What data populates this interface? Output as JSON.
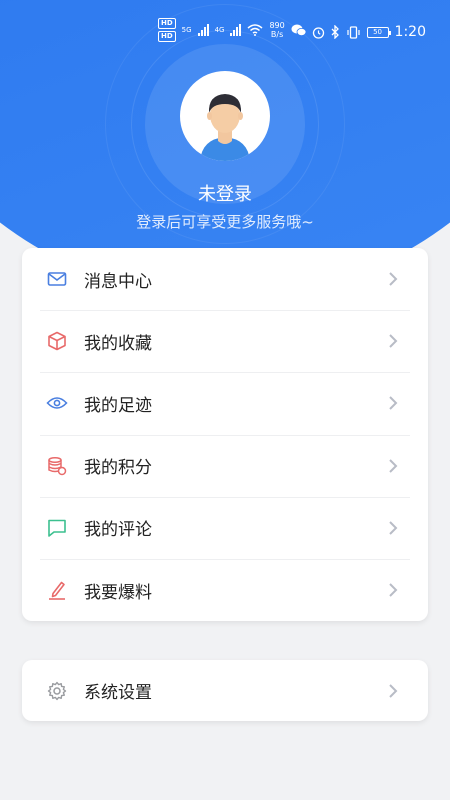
{
  "status_bar": {
    "left_badges": [
      "HD",
      "HD"
    ],
    "network": [
      "5G",
      "4G"
    ],
    "net_speed_value": "890",
    "net_speed_unit": "B/s",
    "battery": "50",
    "time": "1:20"
  },
  "profile": {
    "username": "未登录",
    "subtitle": "登录后可享受更多服务哦~"
  },
  "menu": {
    "items": [
      {
        "label": "消息中心",
        "icon": "mail-icon",
        "color": "#4a7fe0"
      },
      {
        "label": "我的收藏",
        "icon": "box-icon",
        "color": "#e86a6a"
      },
      {
        "label": "我的足迹",
        "icon": "eye-icon",
        "color": "#4a7fe0"
      },
      {
        "label": "我的积分",
        "icon": "coins-icon",
        "color": "#e86a6a"
      },
      {
        "label": "我的评论",
        "icon": "comment-icon",
        "color": "#3cc08f"
      },
      {
        "label": "我要爆料",
        "icon": "edit-icon",
        "color": "#e86a6a"
      }
    ]
  },
  "settings": {
    "label": "系统设置",
    "icon": "gear-icon",
    "color": "#9a9ca0"
  },
  "colors": {
    "header_blue": "#2f7bf0",
    "chevron": "#b8bcc6"
  }
}
